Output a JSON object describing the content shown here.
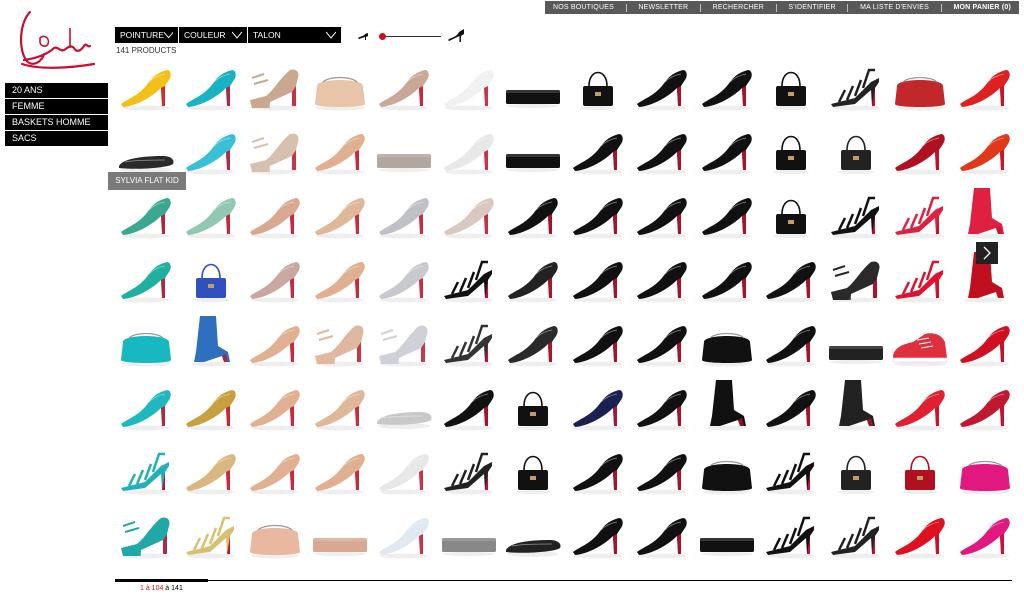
{
  "brand": {
    "logo_text": "Louboutin",
    "color": "#c8102e"
  },
  "topnav": {
    "items": [
      "NOS BOUTIQUES",
      "NEWSLETTER",
      "RECHERCHER",
      "S'IDENTIFIER",
      "MA LISTE D'ENVIES"
    ],
    "cart": "MON PANIER (0)"
  },
  "leftnav": {
    "items": [
      "20 ANS",
      "FEMME",
      "BASKETS HOMME",
      "SACS"
    ]
  },
  "filters": {
    "pointure": "POINTURE",
    "couleur": "COULEUR",
    "talon": "TALON"
  },
  "product_count": "141 PRODUCTS",
  "tooltip": "SYLVIA FLAT KID",
  "pagination": {
    "range": "1 à 104",
    "sep": " à ",
    "total": "141"
  },
  "colors": {
    "nav_bg": "#595959",
    "accent_red": "#cc1020",
    "black": "#000000",
    "tooltip_bg": "#7a7a7a"
  },
  "grid": {
    "rows": [
      [
        {
          "type": "pump",
          "color": "#f2c019"
        },
        {
          "type": "pump",
          "color": "#19b3c4"
        },
        {
          "type": "platform",
          "color": "#caa890"
        },
        {
          "type": "clutch",
          "color": "#e8c4a8"
        },
        {
          "type": "pump",
          "color": "#c9a898"
        },
        {
          "type": "pump",
          "color": "#f1f1f1"
        },
        {
          "type": "clutchbar",
          "color": "#111111"
        },
        {
          "type": "bag",
          "color": "#111111"
        },
        {
          "type": "pump",
          "color": "#111111"
        },
        {
          "type": "pump",
          "color": "#111111"
        },
        {
          "type": "bag",
          "color": "#111111"
        },
        {
          "type": "sandal",
          "color": "#222222"
        },
        {
          "type": "clutch",
          "color": "#c0282c"
        },
        {
          "type": "pump",
          "color": "#e02020"
        }
      ],
      [
        {
          "type": "flat",
          "color": "#2a2a2a"
        },
        {
          "type": "pump",
          "color": "#38c0d8"
        },
        {
          "type": "platform",
          "color": "#d8c0b0"
        },
        {
          "type": "pump",
          "color": "#e0b090"
        },
        {
          "type": "clutchbar",
          "color": "#b0a8a0"
        },
        {
          "type": "pump",
          "color": "#e8e8e8"
        },
        {
          "type": "clutchbar",
          "color": "#111111"
        },
        {
          "type": "pump",
          "color": "#111111"
        },
        {
          "type": "pump",
          "color": "#111111"
        },
        {
          "type": "pump",
          "color": "#111111"
        },
        {
          "type": "bag",
          "color": "#111111"
        },
        {
          "type": "bag",
          "color": "#222222"
        },
        {
          "type": "pump",
          "color": "#b01020"
        },
        {
          "type": "pump",
          "color": "#e03818"
        }
      ],
      [
        {
          "type": "pump",
          "color": "#3aa890"
        },
        {
          "type": "pump",
          "color": "#90c8b0"
        },
        {
          "type": "pump",
          "color": "#d8a890"
        },
        {
          "type": "pump",
          "color": "#e0b898"
        },
        {
          "type": "pump",
          "color": "#c0c0c8"
        },
        {
          "type": "pump",
          "color": "#d8c8c0"
        },
        {
          "type": "pump",
          "color": "#111111"
        },
        {
          "type": "pump",
          "color": "#111111"
        },
        {
          "type": "pump",
          "color": "#111111"
        },
        {
          "type": "pump",
          "color": "#111111"
        },
        {
          "type": "bag",
          "color": "#111111"
        },
        {
          "type": "sandal",
          "color": "#111111"
        },
        {
          "type": "sandal",
          "color": "#e02040"
        },
        {
          "type": "boot",
          "color": "#e02040"
        }
      ],
      [
        {
          "type": "pump",
          "color": "#20b0a0"
        },
        {
          "type": "bag",
          "color": "#3050c0"
        },
        {
          "type": "pump",
          "color": "#c8a8a0"
        },
        {
          "type": "pump",
          "color": "#e0b090"
        },
        {
          "type": "pump",
          "color": "#c8c8d0"
        },
        {
          "type": "sandal",
          "color": "#111111"
        },
        {
          "type": "pump",
          "color": "#222222"
        },
        {
          "type": "pump",
          "color": "#111111"
        },
        {
          "type": "pump",
          "color": "#111111"
        },
        {
          "type": "pump",
          "color": "#111111"
        },
        {
          "type": "pump",
          "color": "#111111"
        },
        {
          "type": "platform",
          "color": "#2a2a2a"
        },
        {
          "type": "sandal",
          "color": "#e01030"
        },
        {
          "type": "boot",
          "color": "#c01020"
        }
      ],
      [
        {
          "type": "clutch",
          "color": "#18b8c0"
        },
        {
          "type": "boot",
          "color": "#2f6fbf"
        },
        {
          "type": "pump",
          "color": "#e0b090"
        },
        {
          "type": "platform",
          "color": "#e0b8a0"
        },
        {
          "type": "platform",
          "color": "#d0d0d8"
        },
        {
          "type": "sandal",
          "color": "#333333"
        },
        {
          "type": "pump",
          "color": "#2a2a2a"
        },
        {
          "type": "pump",
          "color": "#111111"
        },
        {
          "type": "pump",
          "color": "#111111"
        },
        {
          "type": "clutch",
          "color": "#111111"
        },
        {
          "type": "pump",
          "color": "#111111"
        },
        {
          "type": "clutchbar",
          "color": "#222222"
        },
        {
          "type": "sneaker",
          "color": "#e03040"
        },
        {
          "type": "pump",
          "color": "#d01020"
        }
      ],
      [
        {
          "type": "pump",
          "color": "#20b8c0"
        },
        {
          "type": "pump",
          "color": "#c8a040"
        },
        {
          "type": "pump",
          "color": "#e0b090"
        },
        {
          "type": "pump",
          "color": "#e0b898"
        },
        {
          "type": "flat",
          "color": "#c8c8c8"
        },
        {
          "type": "pump",
          "color": "#111111"
        },
        {
          "type": "bag",
          "color": "#111111"
        },
        {
          "type": "pump",
          "color": "#1a2050"
        },
        {
          "type": "pump",
          "color": "#111111"
        },
        {
          "type": "boot",
          "color": "#111111"
        },
        {
          "type": "pump",
          "color": "#111111"
        },
        {
          "type": "boot",
          "color": "#222222"
        },
        {
          "type": "pump",
          "color": "#e02030"
        },
        {
          "type": "pump",
          "color": "#c01830"
        }
      ],
      [
        {
          "type": "sandal",
          "color": "#20b0b8"
        },
        {
          "type": "pump",
          "color": "#d8b880"
        },
        {
          "type": "pump",
          "color": "#e0b090"
        },
        {
          "type": "pump",
          "color": "#e0b090"
        },
        {
          "type": "pump",
          "color": "#e8e8e8"
        },
        {
          "type": "sandal",
          "color": "#222222"
        },
        {
          "type": "bag",
          "color": "#111111"
        },
        {
          "type": "pump",
          "color": "#111111"
        },
        {
          "type": "pump",
          "color": "#111111"
        },
        {
          "type": "clutch",
          "color": "#111111"
        },
        {
          "type": "sandal",
          "color": "#111111"
        },
        {
          "type": "bag",
          "color": "#222222"
        },
        {
          "type": "bag",
          "color": "#b01020"
        },
        {
          "type": "clutch",
          "color": "#e01880"
        }
      ],
      [
        {
          "type": "platform",
          "color": "#20a8a8"
        },
        {
          "type": "sandal",
          "color": "#d8c070"
        },
        {
          "type": "clutch",
          "color": "#e8b8a0"
        },
        {
          "type": "clutchbar",
          "color": "#d8a890"
        },
        {
          "type": "pump",
          "color": "#e0e8f0"
        },
        {
          "type": "clutchbar",
          "color": "#888888"
        },
        {
          "type": "flat",
          "color": "#222222"
        },
        {
          "type": "pump",
          "color": "#111111"
        },
        {
          "type": "pump",
          "color": "#111111"
        },
        {
          "type": "clutchbar",
          "color": "#111111"
        },
        {
          "type": "sandal",
          "color": "#111111"
        },
        {
          "type": "sandal",
          "color": "#222222"
        },
        {
          "type": "pump",
          "color": "#e01020"
        },
        {
          "type": "pump",
          "color": "#e01880"
        }
      ]
    ]
  }
}
